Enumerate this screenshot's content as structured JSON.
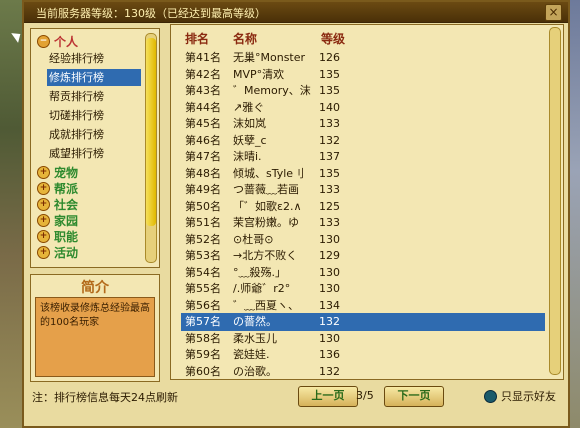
{
  "window": {
    "title": "当前服务器等级：130级（已经达到最高等级）",
    "close_symbol": "×"
  },
  "tree": {
    "expanded_category": {
      "icon": "minus-icon",
      "label": "个人"
    },
    "items": [
      {
        "label": "经验排行榜",
        "selected": false
      },
      {
        "label": "修炼排行榜",
        "selected": true
      },
      {
        "label": "帮贡排行榜",
        "selected": false
      },
      {
        "label": "切磋排行榜",
        "selected": false
      },
      {
        "label": "成就排行榜",
        "selected": false
      },
      {
        "label": "威望排行榜",
        "selected": false
      }
    ],
    "collapsed_categories": [
      {
        "icon": "plus-icon",
        "label": "宠物"
      },
      {
        "icon": "plus-icon",
        "label": "帮派"
      },
      {
        "icon": "plus-icon",
        "label": "社会"
      },
      {
        "icon": "plus-icon",
        "label": "家园"
      },
      {
        "icon": "plus-icon",
        "label": "职能"
      },
      {
        "icon": "plus-icon",
        "label": "活动"
      }
    ]
  },
  "intro": {
    "title": "简介",
    "body": "该榜收录修炼总经验最高的100名玩家"
  },
  "table": {
    "headers": {
      "rank": "排名",
      "name": "名称",
      "level": "等级"
    },
    "rows": [
      {
        "rank": "第41名",
        "name": "无巢°Monster",
        "level": "126"
      },
      {
        "rank": "第42名",
        "name": "MVP°清欢",
        "level": "135"
      },
      {
        "rank": "第43名",
        "name": "゛Memory、沫",
        "level": "135"
      },
      {
        "rank": "第44名",
        "name": "↗雅ぐ",
        "level": "140"
      },
      {
        "rank": "第45名",
        "name": "沫如岚",
        "level": "133"
      },
      {
        "rank": "第46名",
        "name": "妖孽_c",
        "level": "132"
      },
      {
        "rank": "第47名",
        "name": "沫晴ⅰ.",
        "level": "137"
      },
      {
        "rank": "第48名",
        "name": "倾城、sTyle刂",
        "level": "135"
      },
      {
        "rank": "第49名",
        "name": "つ蔷薇﹏若画",
        "level": "133"
      },
      {
        "rank": "第50名",
        "name": "「゛如歌ε2.∧",
        "level": "125"
      },
      {
        "rank": "第51名",
        "name": "茉宫粉嫩。ゆ",
        "level": "133"
      },
      {
        "rank": "第52名",
        "name": "⊙杜哥⊙",
        "level": "130"
      },
      {
        "rank": "第53名",
        "name": "→北方不败く",
        "level": "129"
      },
      {
        "rank": "第54名",
        "name": "°﹏殺殇.」",
        "level": "130"
      },
      {
        "rank": "第55名",
        "name": "/.师爺゛r2°",
        "level": "130"
      },
      {
        "rank": "第56名",
        "name": "゛﹏西夏ヽ、",
        "level": "134"
      },
      {
        "rank": "第57名",
        "name": "の薔然。",
        "level": "132",
        "selected": true
      },
      {
        "rank": "第58名",
        "name": "柔水玉儿",
        "level": "130"
      },
      {
        "rank": "第59名",
        "name": "瓷娃娃.",
        "level": "136"
      },
      {
        "rank": "第60名",
        "name": "の治歌。",
        "level": "132"
      }
    ]
  },
  "footer": {
    "note": "注：排行榜信息每天24点刷新",
    "prev_label": "上一页",
    "next_label": "下一页",
    "page_info": "3/5",
    "friends_only_label": "只显示好友"
  }
}
